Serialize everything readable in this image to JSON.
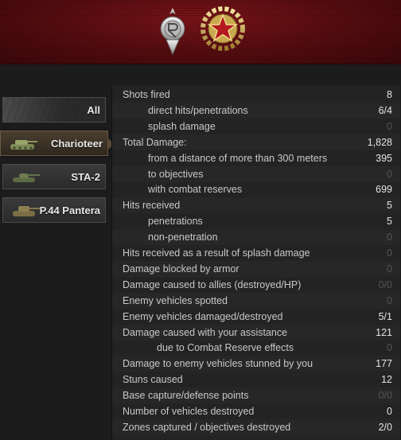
{
  "header": {
    "medals": [
      {
        "icon": "silver-emblem-icon"
      },
      {
        "icon": "gold-star-wreath-icon"
      }
    ]
  },
  "tabs": [
    {
      "label": "All",
      "icon": "all-vehicles-icon",
      "active": false
    },
    {
      "label": "Charioteer",
      "icon": "tank-icon",
      "active": true
    },
    {
      "label": "STA-2",
      "icon": "tank-icon",
      "active": false
    },
    {
      "label": "P.44 Pantera",
      "icon": "tank-icon",
      "active": false
    }
  ],
  "stats": [
    {
      "label": "Shots fired",
      "value": "8",
      "indent": 0,
      "dim": false
    },
    {
      "label": "direct hits/penetrations",
      "value": "6/4",
      "indent": 1,
      "dim": false
    },
    {
      "label": "splash damage",
      "value": "0",
      "indent": 1,
      "dim": true
    },
    {
      "label": "Total Damage:",
      "value": "1,828",
      "indent": 0,
      "dim": false
    },
    {
      "label": "from a distance of more than 300 meters",
      "value": "395",
      "indent": 1,
      "dim": false
    },
    {
      "label": "to objectives",
      "value": "0",
      "indent": 1,
      "dim": true
    },
    {
      "label": "with combat reserves",
      "value": "699",
      "indent": 1,
      "dim": false
    },
    {
      "label": "Hits received",
      "value": "5",
      "indent": 0,
      "dim": false
    },
    {
      "label": "penetrations",
      "value": "5",
      "indent": 1,
      "dim": false
    },
    {
      "label": "non-penetration",
      "value": "0",
      "indent": 1,
      "dim": true
    },
    {
      "label": "Hits received as a result of splash damage",
      "value": "0",
      "indent": 0,
      "dim": true
    },
    {
      "label": "Damage blocked by armor",
      "value": "0",
      "indent": 0,
      "dim": true
    },
    {
      "label": "Damage caused to allies (destroyed/HP)",
      "value": "0/0",
      "indent": 0,
      "dim": true
    },
    {
      "label": "Enemy vehicles spotted",
      "value": "0",
      "indent": 0,
      "dim": true
    },
    {
      "label": "Enemy vehicles damaged/destroyed",
      "value": "5/1",
      "indent": 0,
      "dim": false
    },
    {
      "label": "Damage caused with your assistance",
      "value": "121",
      "indent": 0,
      "dim": false
    },
    {
      "label": "due to Combat Reserve effects",
      "value": "0",
      "indent": 2,
      "dim": true
    },
    {
      "label": "Damage to enemy vehicles stunned by you",
      "value": "177",
      "indent": 0,
      "dim": false
    },
    {
      "label": "Stuns caused",
      "value": "12",
      "indent": 0,
      "dim": false
    },
    {
      "label": "Base capture/defense points",
      "value": "0/0",
      "indent": 0,
      "dim": true
    },
    {
      "label": "Number of vehicles destroyed",
      "value": "0",
      "indent": 0,
      "dim": false
    },
    {
      "label": "Zones captured / objectives destroyed",
      "value": "2/0",
      "indent": 0,
      "dim": false
    }
  ]
}
